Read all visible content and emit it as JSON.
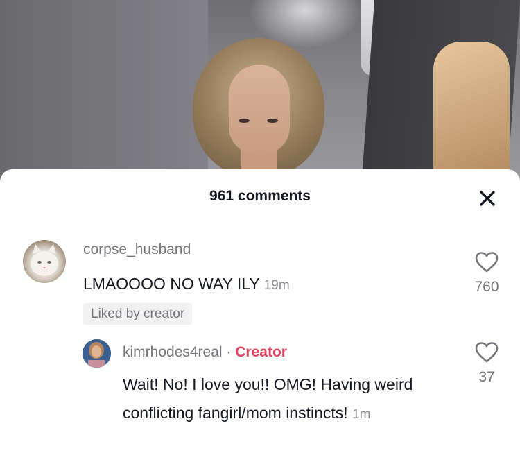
{
  "header": {
    "comment_count": "961 comments"
  },
  "comments": [
    {
      "username": "corpse_husband",
      "text": "LMAOOOO NO WAY ILY",
      "time": "19m",
      "badge": "Liked by creator",
      "likes": "760",
      "avatar": "white-cat-avatar"
    }
  ],
  "replies": [
    {
      "username": "kimrhodes4real",
      "separator": "·",
      "creator_tag": "Creator",
      "text": "Wait! No! I love you!! OMG! Having weird conflicting fangirl/mom instincts!",
      "time": "1m",
      "likes": "37",
      "avatar": "kim-avatar"
    }
  ],
  "icons": {
    "close": "close-icon",
    "like": "heart-outline-icon"
  },
  "colors": {
    "creator": "#e1445f",
    "text": "#161823",
    "secondary": "#74757b",
    "sheet": "#ffffff"
  }
}
